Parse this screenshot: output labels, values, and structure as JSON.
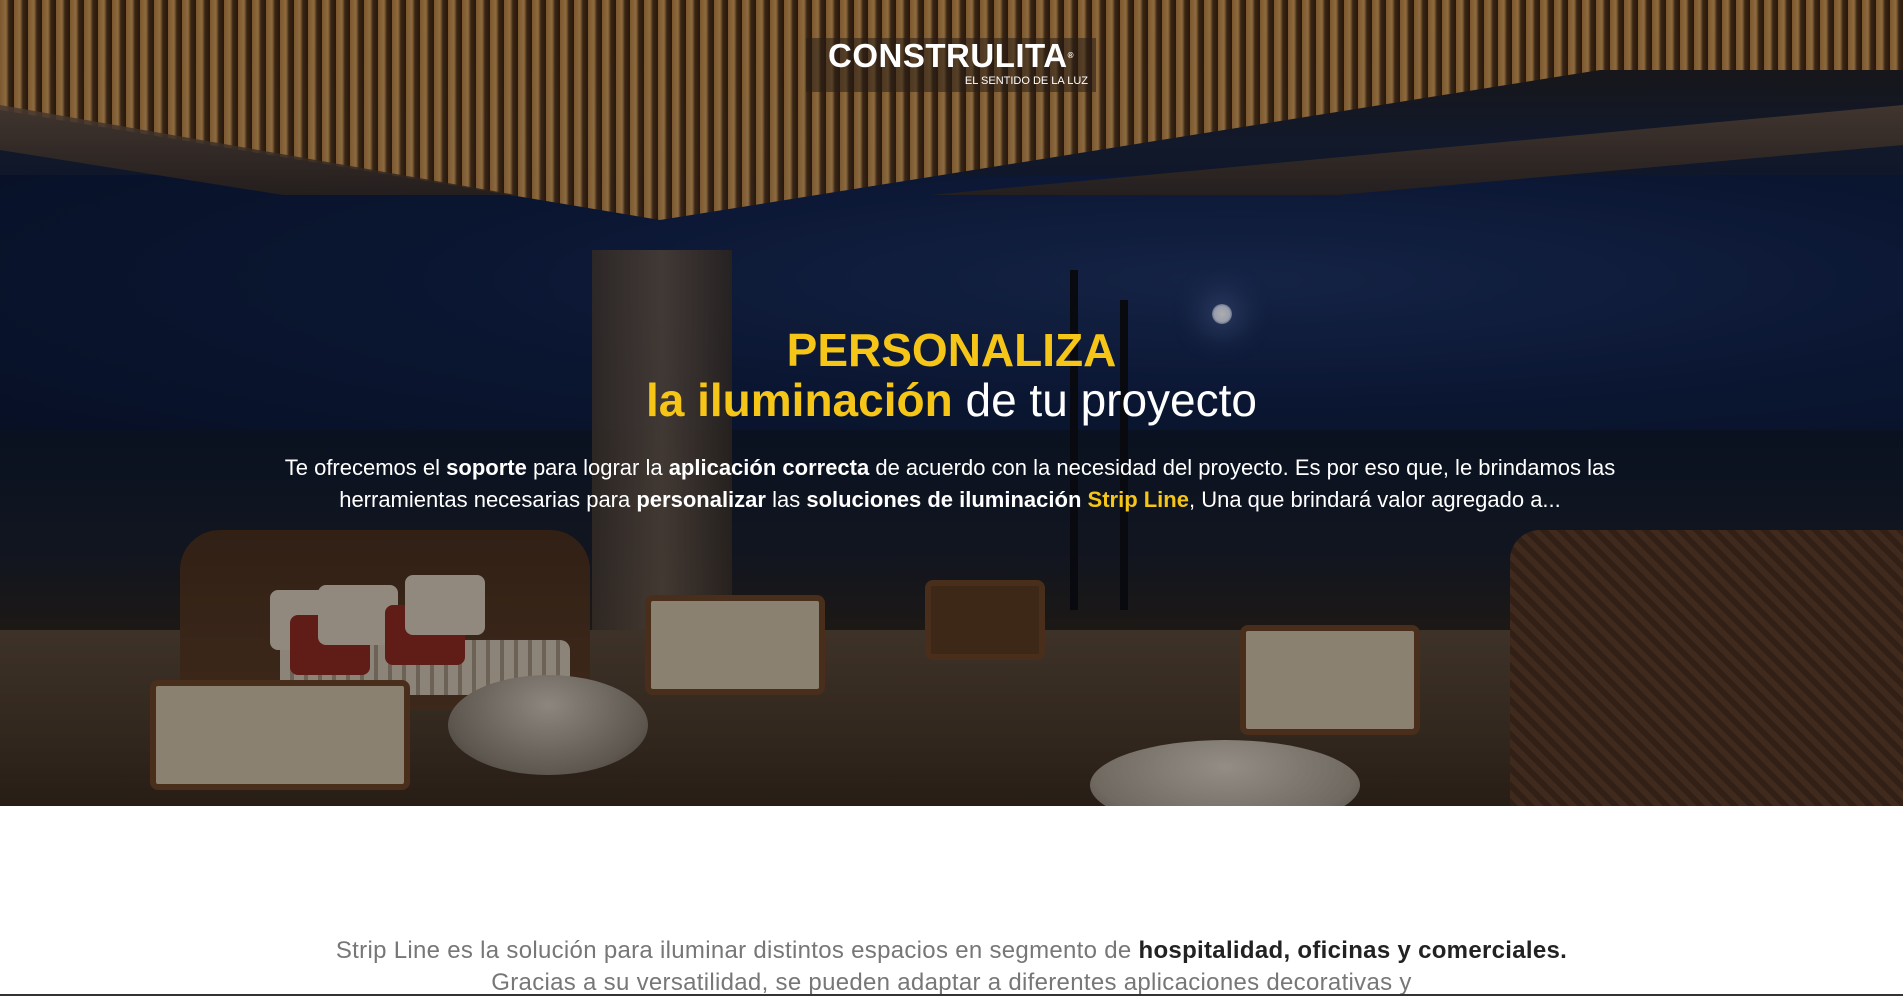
{
  "logo": {
    "brand": "CONSTRULITA",
    "registered": "®",
    "tagline": "EL SENTIDO DE LA LUZ"
  },
  "hero": {
    "title_line1": "PERSONALIZA",
    "title_line2_highlight": "la iluminación",
    "title_line2_rest": " de tu proyecto",
    "body": {
      "t1": "Te ofrecemos el ",
      "b1": "soporte",
      "t2": " para lograr la ",
      "b2": "aplicación correcta",
      "t3": " de acuerdo con la necesidad del proyecto. Es por eso que, le brindamos las herramientas necesarias para ",
      "b3": "personalizar",
      "t4": " las ",
      "b4": "soluciones de iluminación",
      "t5": " ",
      "y1": "Strip Line",
      "t6": ", Una que brindará valor agregado a..."
    }
  },
  "section": {
    "t1": "Strip Line es la solución para iluminar distintos espacios en segmento de ",
    "b1": "hospitalidad, oficinas y comerciales.",
    "t2": " Gracias a su versatilidad, se pueden adaptar a diferentes aplicaciones decorativas y"
  },
  "colors": {
    "accent": "#f5c518",
    "text_light": "#ffffff",
    "section_text": "#777777"
  }
}
